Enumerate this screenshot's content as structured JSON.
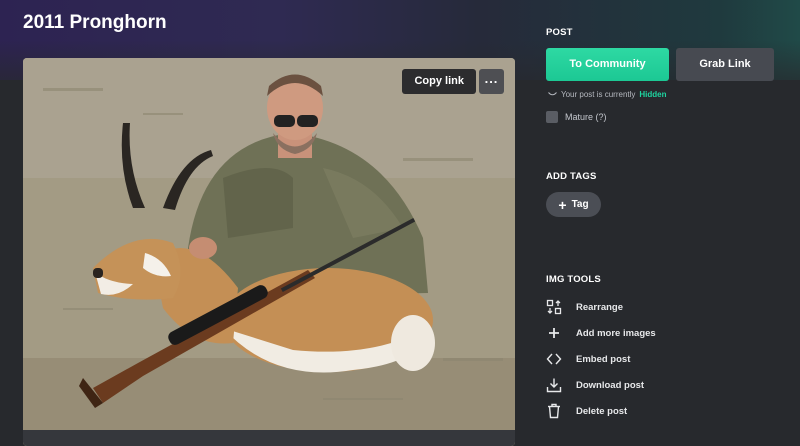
{
  "post": {
    "title": "2011 Pronghorn"
  },
  "image": {
    "copy_link_label": "Copy link",
    "more_label": "..."
  },
  "sidebar": {
    "post_section_label": "POST",
    "to_community_label": "To Community",
    "grab_link_label": "Grab Link",
    "visibility_prefix": "Your post is currently",
    "visibility_status": "Hidden",
    "mature_label": "Mature (?)",
    "add_tags_label": "ADD TAGS",
    "tag_button_label": "Tag",
    "img_tools_label": "IMG TOOLS",
    "tools": [
      {
        "label": "Rearrange",
        "icon": "rearrange-icon"
      },
      {
        "label": "Add more images",
        "icon": "plus-icon"
      },
      {
        "label": "Embed post",
        "icon": "code-icon"
      },
      {
        "label": "Download post",
        "icon": "download-icon"
      },
      {
        "label": "Delete post",
        "icon": "trash-icon"
      }
    ]
  },
  "colors": {
    "accent": "#1ed4a0",
    "background": "#27292d",
    "button_secondary": "#474a51"
  }
}
